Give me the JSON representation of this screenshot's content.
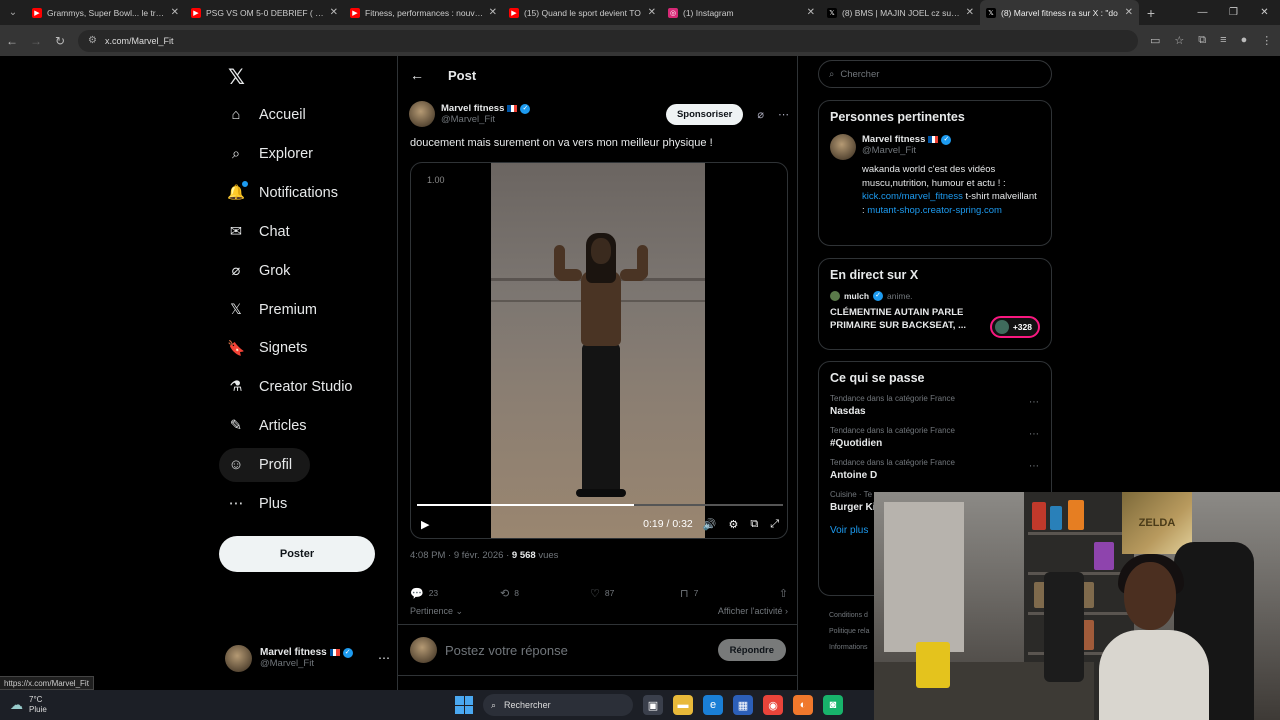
{
  "browser": {
    "tabs": [
      {
        "title": "Grammys, Super Bowl... le triomphe",
        "favicon": "youtube-icon",
        "color": "#ff0000",
        "active": false
      },
      {
        "title": "PSG VS OM 5-0 DEBRIEF ( Le Cl",
        "favicon": "youtube-icon",
        "color": "#ff0000",
        "active": false
      },
      {
        "title": "Fitness, performances : nouvea",
        "favicon": "youtube-icon",
        "color": "#ff0000",
        "active": false
      },
      {
        "title": "(15) Quand le sport devient TO",
        "favicon": "youtube-icon",
        "color": "#ff0000",
        "active": false
      },
      {
        "title": "(1) Instagram",
        "favicon": "instagram-icon",
        "color": "#d62976",
        "active": false
      },
      {
        "title": "(8) BMS | MAJIN JOEL cz sur X",
        "favicon": "x-icon",
        "color": "#000000",
        "active": false
      },
      {
        "title": "(8) Marvel fitness ra sur X : \"do",
        "favicon": "x-icon",
        "color": "#000000",
        "active": true
      }
    ],
    "url": "x.com/Marvel_Fit",
    "status_url": "https://x.com/Marvel_Fit"
  },
  "sidebar": {
    "logo": "𝕏",
    "items": [
      {
        "label": "Accueil",
        "icon": "home-icon",
        "glyph": "⌂"
      },
      {
        "label": "Explorer",
        "icon": "search-icon",
        "glyph": "⌕"
      },
      {
        "label": "Notifications",
        "icon": "bell-icon",
        "glyph": "🔔"
      },
      {
        "label": "Chat",
        "icon": "mail-icon",
        "glyph": "✉"
      },
      {
        "label": "Grok",
        "icon": "grok-icon",
        "glyph": "⌀"
      },
      {
        "label": "Premium",
        "icon": "x-premium-icon",
        "glyph": "𝕏"
      },
      {
        "label": "Signets",
        "icon": "bookmark-icon",
        "glyph": "🔖"
      },
      {
        "label": "Creator Studio",
        "icon": "flask-icon",
        "glyph": "⚗"
      },
      {
        "label": "Articles",
        "icon": "article-icon",
        "glyph": "✎"
      },
      {
        "label": "Profil",
        "icon": "person-icon",
        "glyph": "☺"
      },
      {
        "label": "Plus",
        "icon": "more-circle-icon",
        "glyph": "⋯"
      }
    ],
    "post_button": "Poster",
    "account": {
      "name": "Marvel fitness",
      "handle": "@Marvel_Fit"
    }
  },
  "main": {
    "header_title": "Post",
    "tweet": {
      "name": "Marvel fitness",
      "handle": "@Marvel_Fit",
      "sponsor_label": "Sponsoriser",
      "text": "doucement mais surement on va vers mon meilleur physique !",
      "video": {
        "zoom": "1.00",
        "time": "0:19 / 0:32",
        "progress": 0.594
      },
      "meta_time": "4:08 PM · 9 févr. 2026 · ",
      "views": "9 568",
      "views_label": " vues",
      "replies": "23",
      "reposts": "8",
      "likes": "87",
      "bookmarks": "7"
    },
    "sort_label": "Pertinence",
    "activity_label": "Afficher l'activité",
    "reply_placeholder": "Postez votre réponse",
    "reply_button": "Répondre"
  },
  "right": {
    "search_placeholder": "Chercher",
    "relevant": {
      "title": "Personnes pertinentes",
      "name": "Marvel fitness",
      "handle": "@Marvel_Fit",
      "bio_1": "wakanda world c'est des vidéos muscu,nutrition, humour et actu ! :",
      "bio_link_1": "kick.com/marvel_fitness",
      "bio_2": " t-shirt malveillant : ",
      "bio_link_2": "mutant-shop.creator-spring.com"
    },
    "live": {
      "title": "En direct sur X",
      "user": "mulch",
      "user_suffix": " anime.",
      "headline": "CLÉMENTINE AUTAIN PARLE PRIMAIRE SUR BACKSEAT, ...",
      "listeners": "+328"
    },
    "trends": {
      "title": "Ce qui se passe",
      "items": [
        {
          "category": "Tendance dans la catégorie France",
          "term": "Nasdas"
        },
        {
          "category": "Tendance dans la catégorie France",
          "term": "#Quotidien"
        },
        {
          "category": "Tendance dans la catégorie France",
          "term": "Antoine D"
        },
        {
          "category": "Cuisine · Te",
          "term": "Burger Ki"
        }
      ],
      "see_more": "Voir plus"
    },
    "footer": [
      "Conditions d",
      "Politique rela",
      "Informations"
    ]
  },
  "webcam": {
    "poster_text": "ZELDA"
  },
  "taskbar": {
    "temperature": "7°C",
    "condition": "Pluie",
    "search_label": "Rechercher"
  },
  "colors": {
    "accent": "#1d9bf0",
    "live": "#f91880",
    "verified": "#1d9bf0"
  }
}
